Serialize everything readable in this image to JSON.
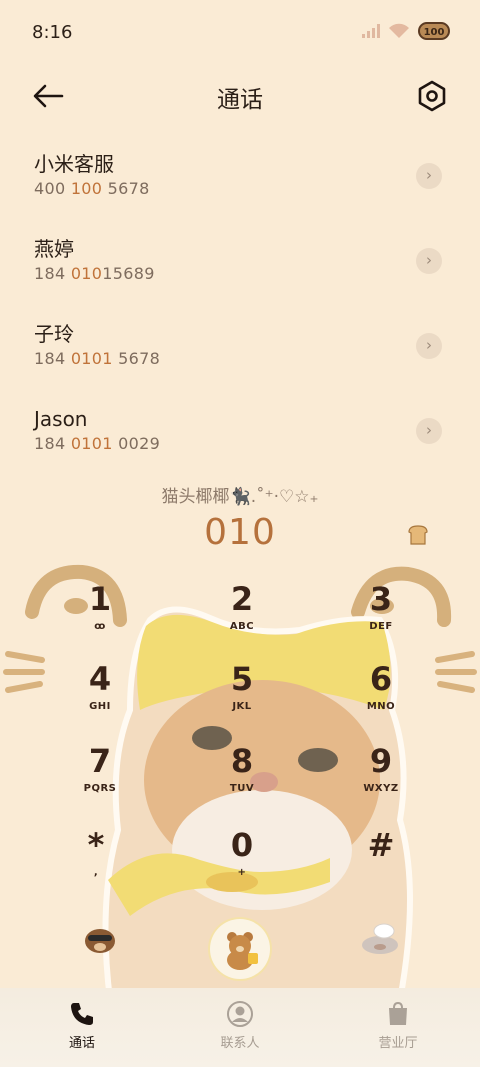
{
  "status_bar": {
    "time": "8:16",
    "battery_label": "100"
  },
  "header": {
    "title": "通话"
  },
  "call_log": [
    {
      "name": "小米客服",
      "number_pre": "400 ",
      "number_highlight": "100",
      "number_post": " 5678"
    },
    {
      "name": "燕婷",
      "number_pre": "184 ",
      "number_highlight": "010",
      "number_post": "15689"
    },
    {
      "name": "子玲",
      "number_pre": "184 ",
      "number_highlight": "0101",
      "number_post": " 5678"
    },
    {
      "name": "Jason",
      "number_pre": "184 ",
      "number_highlight": "0101",
      "number_post": " 0029"
    }
  ],
  "dialer": {
    "caption": "猫头椰椰🐈‍⬛.˚⁺‧♡☆₊",
    "entered_number": "010"
  },
  "keypad": [
    {
      "digit": "1",
      "letters": "ꝏ"
    },
    {
      "digit": "2",
      "letters": "ABC"
    },
    {
      "digit": "3",
      "letters": "DEF"
    },
    {
      "digit": "4",
      "letters": "GHI"
    },
    {
      "digit": "5",
      "letters": "JKL"
    },
    {
      "digit": "6",
      "letters": "MNO"
    },
    {
      "digit": "7",
      "letters": "PQRS"
    },
    {
      "digit": "8",
      "letters": "TUV"
    },
    {
      "digit": "9",
      "letters": "WXYZ"
    },
    {
      "digit": "*",
      "letters": ","
    },
    {
      "digit": "0",
      "letters": "+"
    },
    {
      "digit": "#",
      "letters": ""
    }
  ],
  "nav": [
    {
      "label": "通话",
      "icon": "phone-icon",
      "active": true
    },
    {
      "label": "联系人",
      "icon": "contact-icon",
      "active": false
    },
    {
      "label": "营业厅",
      "icon": "store-icon",
      "active": false
    }
  ],
  "colors": {
    "background": "#faebd5",
    "accent": "#b5713c",
    "highlight": "#c0733a"
  }
}
